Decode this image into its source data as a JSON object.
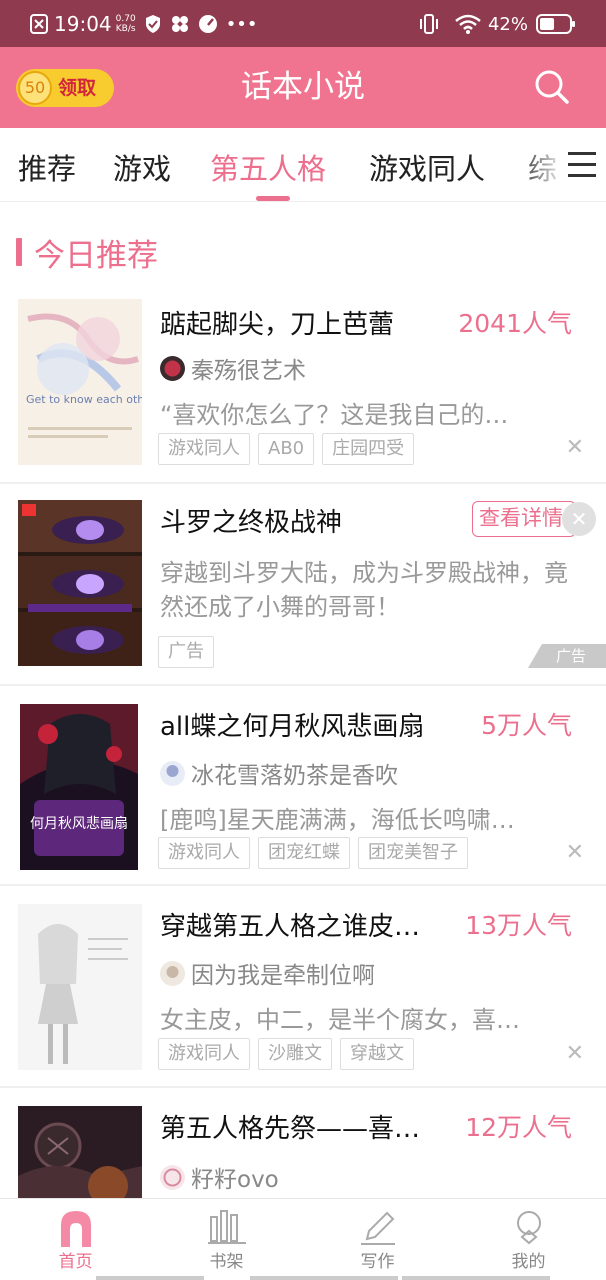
{
  "status_bar": {
    "time": "19:04",
    "net_speed_value": "0.70",
    "net_speed_unit": "KB/s",
    "battery": "42%"
  },
  "header": {
    "reward_coin": "50",
    "reward_label": "领取",
    "title": "话本小说",
    "search_icon": "search-icon"
  },
  "tabs": [
    {
      "label": "推荐",
      "active": false
    },
    {
      "label": "游戏",
      "active": false
    },
    {
      "label": "第五人格",
      "active": true
    },
    {
      "label": "游戏同人",
      "active": false
    },
    {
      "label": "综",
      "active": false
    }
  ],
  "section": {
    "title": "今日推荐"
  },
  "books": [
    {
      "title": "踮起脚尖，刀上芭蕾",
      "popularity": "2041人气",
      "author": "秦殇很艺术",
      "description": "“喜欢你怎么了？这是我自己的…",
      "tags": [
        "游戏同人",
        "AB0",
        "庄园四受"
      ],
      "cover_text": "Get to know each other"
    },
    {
      "title": "all蝶之何月秋风悲画扇",
      "popularity": "5万人气",
      "author": "冰花雪落奶茶是香吹",
      "description": "[鹿鸣]星天鹿满满，海低长鸣啸…",
      "tags": [
        "游戏同人",
        "团宠红蝶",
        "团宠美智子"
      ],
      "cover_text": "何月秋风悲画扇"
    },
    {
      "title": "穿越第五人格之谁皮…",
      "popularity": "13万人气",
      "author": "因为我是牵制位啊",
      "description": "女主皮，中二，是半个腐女，喜…",
      "tags": [
        "游戏同人",
        "沙雕文",
        "穿越文"
      ]
    },
    {
      "title": "第五人格先祭——喜…",
      "popularity": "12万人气",
      "author": "籽籽ovo"
    }
  ],
  "ad": {
    "title": "斗罗之终极战神",
    "description": "穿越到斗罗大陆，成为斗罗殿战神，竟然还成了小舞的哥哥！",
    "tag": "广告",
    "detail_button": "查看详情",
    "badge": "广告"
  },
  "bottom_nav": [
    {
      "label": "首页",
      "icon": "home-icon",
      "active": true
    },
    {
      "label": "书架",
      "icon": "bookshelf-icon",
      "active": false
    },
    {
      "label": "写作",
      "icon": "pen-icon",
      "active": false
    },
    {
      "label": "我的",
      "icon": "profile-icon",
      "active": false
    }
  ],
  "colors": {
    "status_bar": "#8f3a4e",
    "header": "#f07490",
    "accent": "#ec6f8e",
    "reward": "#f8cb2e"
  }
}
